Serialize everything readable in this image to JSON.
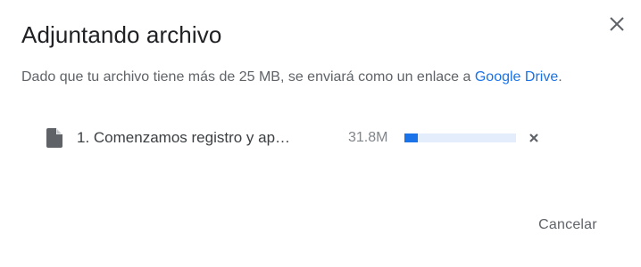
{
  "dialog": {
    "title": "Adjuntando archivo",
    "close_icon": "close-icon",
    "message_text": "Dado que tu archivo tiene más de 25 MB, se enviará como un enlace a ",
    "message_link": "Google Drive",
    "message_end": "."
  },
  "file": {
    "icon": "file-icon",
    "name": "1. Comenzamos registro y ap…",
    "size": "31.8M",
    "progress_fraction": 0.12,
    "remove_icon": "remove-icon"
  },
  "actions": {
    "cancel_label": "Cancelar"
  },
  "colors": {
    "link": "#1a73e8",
    "progress_fill": "#1a73e8",
    "progress_track": "#e3edfb"
  }
}
